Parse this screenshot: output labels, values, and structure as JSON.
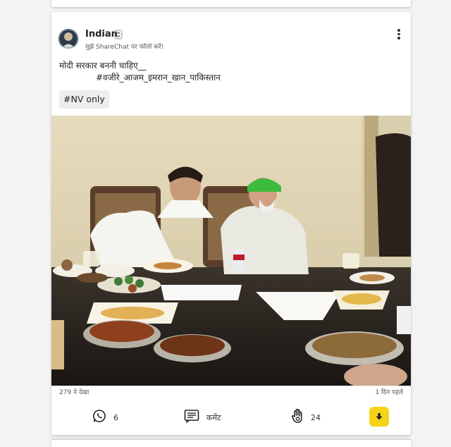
{
  "post": {
    "author": "Indian",
    "follow_hint": "मुझे ShareChat पर फॉलो करें!",
    "caption_line1": "मोदी सरकार बननी चाहिए__",
    "caption_line2": "#वजीरे_आजम_इमरान_खान_पाकिस्तान",
    "tag": "#NV only",
    "views": "279 ने देखा",
    "time_ago": "1 दिन पहले"
  },
  "actions": {
    "whatsapp_count": "6",
    "comment_label": "कमेंट",
    "like_count": "24"
  },
  "icons": {
    "whatsapp": "whatsapp-icon",
    "comment": "comment-icon",
    "like": "like-hand-icon",
    "download": "download-icon",
    "menu": "more-vertical-icon",
    "verified": "verified-badge-icon"
  },
  "colors": {
    "download_button": "#f5d31a",
    "card_background": "#ffffff",
    "page_background": "#f3f3f3"
  }
}
